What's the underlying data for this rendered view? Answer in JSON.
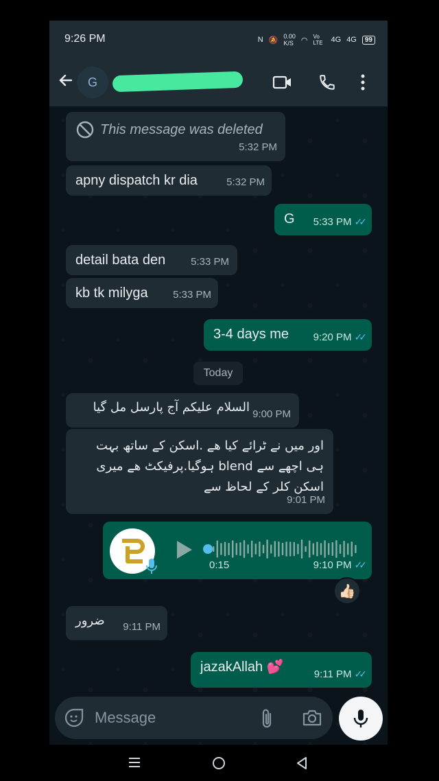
{
  "status": {
    "time": "9:26 PM",
    "net_speed": "0.00",
    "net_unit": "K/S",
    "volte": "Vo LTE",
    "sig1": "4G",
    "sig2": "4G",
    "battery": "99"
  },
  "header": {
    "avatar_letter": "G"
  },
  "messages": [
    {
      "dir": "in",
      "text": "This message was deleted",
      "time": "5:32 PM"
    },
    {
      "dir": "in",
      "text": "apny dispatch kr dia",
      "time": "5:32 PM"
    },
    {
      "dir": "out",
      "text": "G",
      "time": "5:33 PM"
    },
    {
      "dir": "in",
      "text": "detail bata den",
      "time": "5:33 PM"
    },
    {
      "dir": "in",
      "text": "kb tk milyga",
      "time": "5:33 PM"
    },
    {
      "dir": "out",
      "text": "3-4 days me",
      "time": "9:20 PM"
    },
    {
      "dir": "in",
      "text": "السلام علیکم آج پارسل مل گیا",
      "time": "9:00 PM"
    },
    {
      "dir": "in",
      "text": "اور میں نے ٹرائے کیا ھے .اسکن کے ساتھ بہت ہی اچھے سے blend ہوگیا.پرفیکٹ ھے میری اسکن کلر کے لحاظ سے",
      "time": "9:01 PM"
    },
    {
      "dir": "out",
      "voice_duration": "0:15",
      "voice_progress": 0.0,
      "time": "9:10 PM",
      "reaction": "👍🏻"
    },
    {
      "dir": "in",
      "text": "ضرور",
      "time": "9:11 PM"
    },
    {
      "dir": "out",
      "text": "jazakAllah 💕",
      "time": "9:11 PM"
    }
  ],
  "divider": "Today",
  "input": {
    "placeholder": "Message"
  },
  "colors": {
    "outgoing": "#005c4b",
    "incoming": "#202c33",
    "read_tick": "#53bdeb",
    "accent": "#4cf2a6"
  }
}
